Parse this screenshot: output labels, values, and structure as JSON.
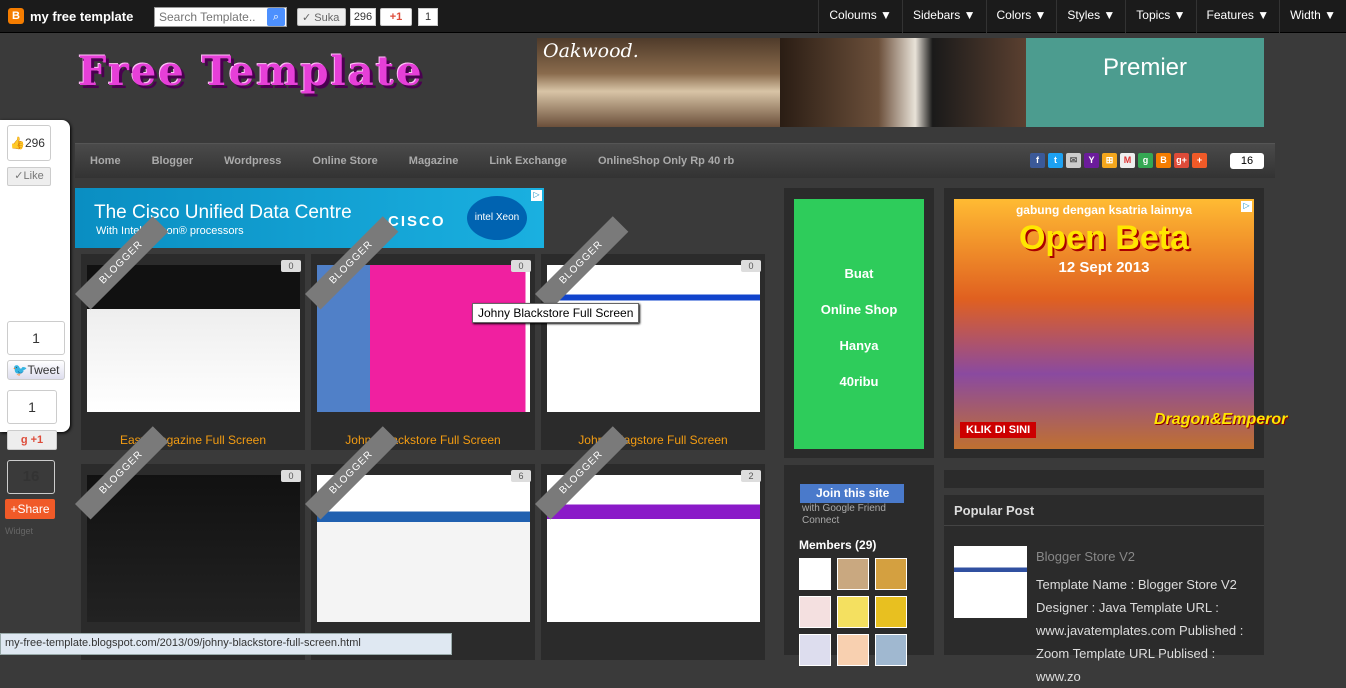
{
  "navbar": {
    "blog_name": "my free template",
    "search_placeholder": "Search Template..",
    "like_label": "Suka",
    "like_count": "296",
    "gplus_label": "+1",
    "gplus_count": "1"
  },
  "top_menu": [
    "Coloums ▼",
    "Sidebars ▼",
    "Colors ▼",
    "Styles ▼",
    "Topics ▼",
    "Features ▼",
    "Width ▼"
  ],
  "header": {
    "site_title": "Free Template",
    "banner_brand": "Oakwood.",
    "banner_tag": "Premier"
  },
  "main_menu": [
    "Home",
    "Blogger",
    "Wordpress",
    "Online Store",
    "Magazine",
    "Link Exchange",
    "OnlineShop Only Rp 40 rb"
  ],
  "share_count": "16",
  "share_icons": [
    "facebook-icon",
    "twitter-icon",
    "email-icon",
    "yahoo-icon",
    "windows-icon",
    "gmail-icon",
    "google-icon",
    "blogger-icon",
    "googleplus-icon",
    "addthis-icon"
  ],
  "float_widget": {
    "fb_count": "296",
    "fb_label": "Like",
    "tweet_count": "1",
    "tweet_label": "Tweet",
    "gplus_count": "1",
    "gplus_label": "+1",
    "share_count": "16",
    "share_label": "Share",
    "widget_label": "Widget"
  },
  "cisco_ad": {
    "headline": "The Cisco Unified Data Centre",
    "sub": "With Intel® Xeon® processors",
    "logo": "CISCO",
    "intel": "intel Xeon"
  },
  "posts": [
    {
      "title": "Easy Magazine Full Screen",
      "count": "0",
      "ribbon": "BLOGGER"
    },
    {
      "title": "Johny Blackstore Full Screen",
      "count": "0",
      "ribbon": "BLOGGER"
    },
    {
      "title": "Johny Magstore Full Screen",
      "count": "0",
      "ribbon": "BLOGGER"
    },
    {
      "title": "",
      "count": "0",
      "ribbon": "BLOGGER"
    },
    {
      "title": "",
      "count": "6",
      "ribbon": "BLOGGER"
    },
    {
      "title": "",
      "count": "2",
      "ribbon": "BLOGGER"
    }
  ],
  "tooltip": "Johny Blackstore Full Screen",
  "green_ad": {
    "l1": "Buat",
    "l2": "Online Shop",
    "l3": "Hanya",
    "l4": "40ribu"
  },
  "game_ad": {
    "t1": "gabung dengan ksatria lainnya",
    "t2": "Open Beta",
    "t3": "12 Sept 2013",
    "t4": "KLIK DI SINI",
    "t5": "Dragon&Emperor"
  },
  "gfc": {
    "button": "Join this site",
    "sub": "with Google Friend Connect",
    "members": "Members (29)"
  },
  "popular": {
    "title": "Popular Post",
    "post_title": "Blogger Store V2",
    "post_text": "Template Name : Blogger Store V2 Designer : Java Template URL : www.javatemplates.com Published : Zoom Template URL Publised : www.zo"
  },
  "status_url": "my-free-template.blogspot.com/2013/09/johny-blackstore-full-screen.html"
}
